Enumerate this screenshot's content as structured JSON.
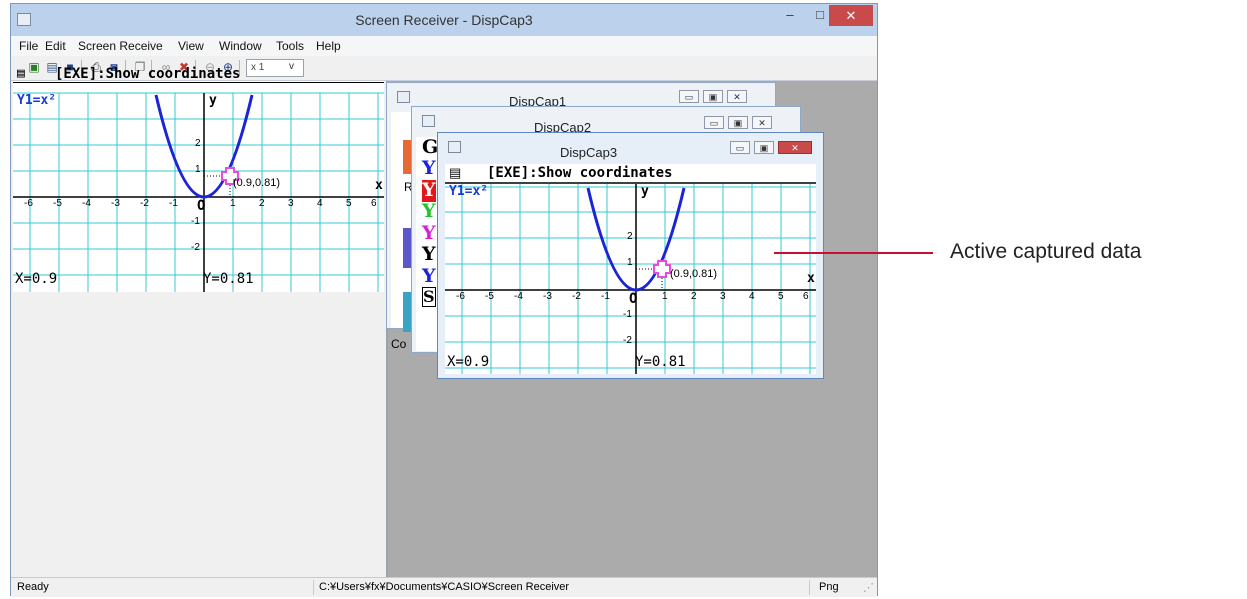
{
  "window": {
    "title": "Screen Receiver - DispCap3",
    "min": "–",
    "max": "□",
    "close": "✕"
  },
  "menu": [
    "File",
    "Edit",
    "Screen Receive",
    "View",
    "Window",
    "Tools",
    "Help"
  ],
  "toolbar": {
    "zoom_value": "x 1",
    "zoom_arrow": "v"
  },
  "left_capture": {
    "header": "[EXE]:Show coordinates",
    "func": "Y1=x²",
    "point_label": "(0.9,0.81)",
    "x_readout": "X=0.9",
    "y_readout": "Y=0.81",
    "x_axis": "x",
    "y_axis": "y",
    "origin": "O",
    "x_ticks": [
      "-6",
      "-5",
      "-4",
      "-3",
      "-2",
      "-1",
      "1",
      "2",
      "3",
      "4",
      "5",
      "6"
    ],
    "y_ticks": [
      "2",
      "1",
      "-1",
      "-2"
    ]
  },
  "children": {
    "c1_title": "DispCap1",
    "c2_title": "DispCap2",
    "c3_title": "DispCap3",
    "c2_letters": [
      "G",
      "Y",
      "Y",
      "Y",
      "Y",
      "Y",
      "Y",
      "S"
    ],
    "c1_frag_r": "R",
    "c1_frag_co": "Co",
    "btn_min": "▭",
    "btn_max": "▣",
    "btn_close": "✕",
    "c3_close": "✕"
  },
  "status": {
    "left": "Ready",
    "path": "C:¥Users¥fx¥Documents¥CASIO¥Screen Receiver",
    "format": "Png"
  },
  "annotation": {
    "label": "Active captured data"
  },
  "colors": {
    "curve": "#1b24d6",
    "grid": "#36c9d6",
    "cursor": "#e84be1",
    "annotation_line": "#c8102e",
    "func_label": "#1a3bd6"
  }
}
